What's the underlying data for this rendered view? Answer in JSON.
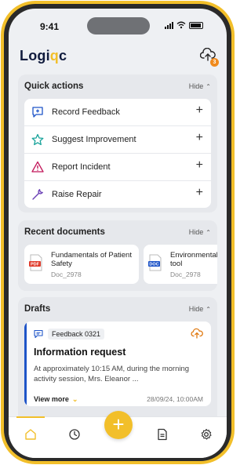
{
  "status": {
    "time": "9:41"
  },
  "header": {
    "logo_part1": "Logi",
    "logo_part2": "q",
    "logo_part3": "c",
    "upload_badge": "3"
  },
  "quick_actions": {
    "title": "Quick actions",
    "hide_label": "Hide",
    "items": [
      {
        "label": "Record Feedback",
        "icon": "feedback-icon"
      },
      {
        "label": "Suggest Improvement",
        "icon": "star-icon"
      },
      {
        "label": "Report Incident",
        "icon": "warning-icon"
      },
      {
        "label": "Raise Repair",
        "icon": "wrench-icon"
      }
    ]
  },
  "recent_documents": {
    "title": "Recent documents",
    "hide_label": "Hide",
    "items": [
      {
        "title": "Fundamentals of Patient Safety",
        "id": "Doc_2978",
        "type": "PDF"
      },
      {
        "title": "Environmental s audit tool",
        "id": "Doc_2978",
        "type": "DOC"
      }
    ]
  },
  "drafts": {
    "title": "Drafts",
    "hide_label": "Hide",
    "items": [
      {
        "tag": "Feedback 0321",
        "title": "Information request",
        "body": "At approximately 10:15 AM, during the morning activity session, Mrs. Eleanor ...",
        "view_more": "View more",
        "date": "28/09/24, 10:00AM"
      }
    ]
  },
  "colors": {
    "accent": "#f2bf2a",
    "brand": "#101b3d",
    "pdf": "#e03b2b",
    "doc": "#1e54c8"
  }
}
